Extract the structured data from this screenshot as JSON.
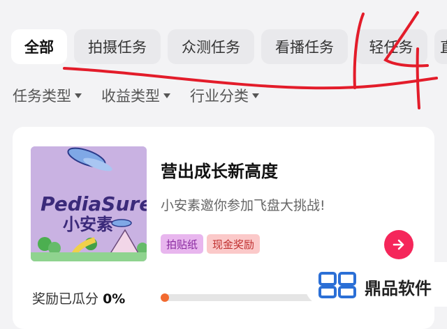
{
  "tabs": [
    {
      "label": "全部",
      "active": true
    },
    {
      "label": "拍摄任务",
      "active": false
    },
    {
      "label": "众测任务",
      "active": false
    },
    {
      "label": "看播任务",
      "active": false
    },
    {
      "label": "轻任务",
      "active": false
    },
    {
      "label": "直",
      "active": false
    }
  ],
  "filters": [
    {
      "label": "任务类型",
      "icon": "caret-down-icon"
    },
    {
      "label": "收益类型",
      "icon": "caret-down-icon"
    },
    {
      "label": "行业分类",
      "icon": "caret-down-icon"
    }
  ],
  "task_card": {
    "thumbnail": {
      "brand_en": "PediaSure",
      "brand_cn": "小安素"
    },
    "title": "营出成长新高度",
    "subtitle": "小安素邀你参加飞盘大挑战!",
    "tags": [
      "拍贴纸",
      "现金奖励"
    ],
    "action_icon": "arrow-right-icon",
    "reward_label": "奖励已瓜分",
    "reward_percent": "0%",
    "progress": 0.0
  },
  "annotation": {
    "text": "14",
    "color": "#e31c2a"
  },
  "watermark": {
    "text": "鼎品软件"
  },
  "colors": {
    "accent": "#f5265a",
    "progress": "#f26a30",
    "tag_purple_bg": "#e8b6ee",
    "tag_red_bg": "#fbc9c9",
    "page_bg": "#f3f3f5"
  }
}
